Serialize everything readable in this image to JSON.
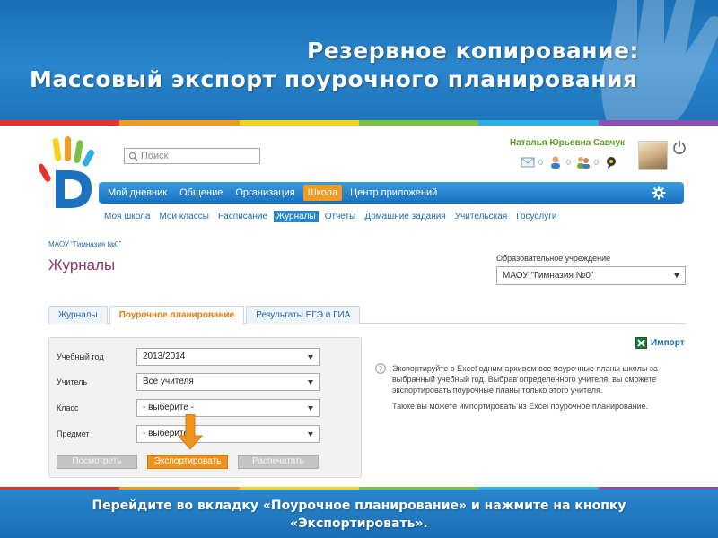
{
  "slide": {
    "title_line1": "Резервное копирование:",
    "title_line2": "Массовый экспорт поурочного планирования",
    "footer_line1": "Перейдите во вкладку «Поурочное планирование» и нажмите на кнопку",
    "footer_line2": "«Экспортировать».",
    "colors": {
      "banner": "#1f74bb",
      "rainbow": [
        "#e8332a",
        "#f29b22",
        "#f5d21b",
        "#7ac142",
        "#2ab0e5",
        "#8a4fb3"
      ]
    }
  },
  "header": {
    "search_placeholder": "Поиск",
    "user_name": "Наталья Юрьевна Савчук",
    "counters": [
      {
        "icon": "mail-icon",
        "count": "0"
      },
      {
        "icon": "person-icon",
        "count": "0"
      },
      {
        "icon": "people-icon",
        "count": "0"
      },
      {
        "icon": "chat-icon",
        "count": ""
      }
    ]
  },
  "main_nav": {
    "items": [
      "Мой дневник",
      "Общение",
      "Организация",
      "Школа",
      "Центр приложений"
    ],
    "active": "Школа"
  },
  "sub_nav": {
    "items": [
      "Моя школа",
      "Мои классы",
      "Расписание",
      "Журналы",
      "Отчеты",
      "Домашние задания",
      "Учительская",
      "Госуслуги"
    ],
    "active": "Журналы"
  },
  "breadcrumb": "МАОУ \"Гимназия №0\"",
  "page_title": "Журналы",
  "org": {
    "label": "Образовательное учреждение",
    "value": "МАОУ \"Гимназия №0\""
  },
  "tabs": {
    "items": [
      "Журналы",
      "Поурочное планирование",
      "Результаты ЕГЭ и ГИА"
    ],
    "active": "Поурочное планирование"
  },
  "form": {
    "fields": [
      {
        "label": "Учебный год",
        "value": "2013/2014"
      },
      {
        "label": "Учитель",
        "value": "Все учителя"
      },
      {
        "label": "Класс",
        "value": "- выберите -"
      },
      {
        "label": "Предмет",
        "value": "- выберите -"
      }
    ],
    "buttons": {
      "view": "Посмотреть",
      "export": "Экспортировать",
      "print": "Распечатать"
    }
  },
  "import_label": "Импорт",
  "info": {
    "text1": "Экспортируйте в Excel одним архивом все поурочные планы школы за выбранный учебный год. Выбрав определенного учителя, вы сможете экспортировать поурочные планы только этого учителя.",
    "text2": "Также вы можете импортировать из Excel поурочное планирование."
  }
}
